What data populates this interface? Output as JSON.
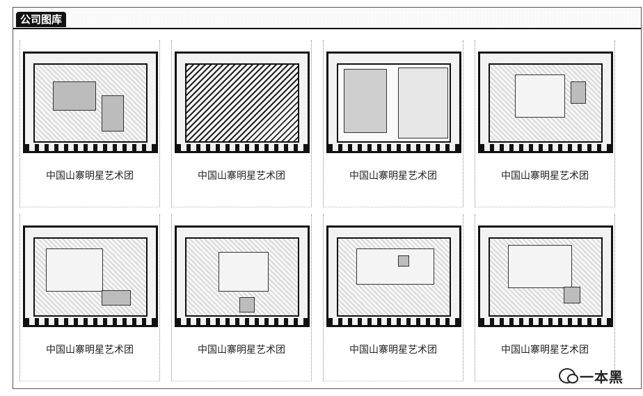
{
  "section": {
    "title": "公司图库"
  },
  "gallery": {
    "items": [
      {
        "caption": "中国山寨明星艺术团"
      },
      {
        "caption": "中国山寨明星艺术团"
      },
      {
        "caption": "中国山寨明星艺术团"
      },
      {
        "caption": "中国山寨明星艺术团"
      },
      {
        "caption": "中国山寨明星艺术团"
      },
      {
        "caption": "中国山寨明星艺术团"
      },
      {
        "caption": "中国山寨明星艺术团"
      },
      {
        "caption": "中国山寨明星艺术团"
      }
    ]
  },
  "watermark": {
    "text": "一本黑",
    "icon": "wechat-icon"
  }
}
